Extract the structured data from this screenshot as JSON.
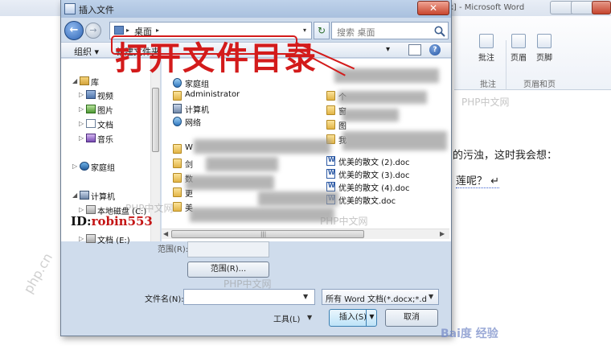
{
  "word": {
    "title": "x] - Microsoft Word",
    "ribbon": {
      "comment_label": "批注",
      "header_label": "页眉",
      "footer_label": "页脚",
      "group_comment": "批注",
      "group_header_footer": "页眉和页"
    },
    "doc_line1": "的污浊，这时我会想：",
    "doc_line2": "莲呢？ ↵"
  },
  "dialog": {
    "title": "插入文件",
    "close_glyph": "✕",
    "address": {
      "location": "桌面",
      "separator": "▸"
    },
    "search_placeholder": "搜索 桌面",
    "toolbar": {
      "organize": "组织 ▾",
      "new_folder": "新建文件夹"
    },
    "nav_tree": [
      {
        "label": "库",
        "icon": "library-icon"
      },
      {
        "label": "视频",
        "icon": "video-folder-icon"
      },
      {
        "label": "图片",
        "icon": "pictures-folder-icon"
      },
      {
        "label": "文档",
        "icon": "documents-folder-icon"
      },
      {
        "label": "音乐",
        "icon": "music-folder-icon"
      },
      {
        "label": "家庭组",
        "icon": "homegroup-icon"
      },
      {
        "label": "计算机",
        "icon": "computer-icon"
      },
      {
        "label": "本地磁盘 (C:)",
        "icon": "drive-icon"
      },
      {
        "label": "文档 (E:)",
        "icon": "drive-icon"
      }
    ],
    "files_col1": [
      {
        "label": "家庭组",
        "icon": "homegroup-icon"
      },
      {
        "label": "Administrator",
        "icon": "user-folder-icon"
      },
      {
        "label": "计算机",
        "icon": "computer-icon"
      },
      {
        "label": "网络",
        "icon": "network-icon"
      },
      {
        "label": "W",
        "icon": "folder-icon"
      },
      {
        "label": "剑",
        "icon": "folder-icon"
      },
      {
        "label": "数",
        "icon": "folder-icon"
      },
      {
        "label": "更",
        "icon": "folder-icon"
      },
      {
        "label": "美",
        "icon": "folder-icon"
      }
    ],
    "files_col2": [
      {
        "label": "个",
        "icon": "folder-icon"
      },
      {
        "label": "窗",
        "icon": "folder-icon"
      },
      {
        "label": "图",
        "icon": "folder-icon"
      },
      {
        "label": "我",
        "icon": "folder-icon"
      },
      {
        "label": "优美的散文 (2).doc",
        "icon": "word-doc-icon"
      },
      {
        "label": "优美的散文 (3).doc",
        "icon": "word-doc-icon"
      },
      {
        "label": "优美的散文 (4).doc",
        "icon": "word-doc-icon"
      },
      {
        "label": "优美的散文.doc",
        "icon": "word-doc-icon"
      }
    ],
    "range_label": "范围(R):",
    "range_button": "范围(R)...",
    "filename_label": "文件名(N):",
    "filename_value": "",
    "filter_value": "所有 Word 文档(*.docx;*.doc",
    "tools_label": "工具(L)",
    "insert_label": "插入(S)",
    "cancel_label": "取消"
  },
  "overlay": {
    "annotation": "打开文件目录",
    "id_prefix": "ID:",
    "id_name": "robin553",
    "watermark": "PHP中文网",
    "watermark_rot": "php.cn",
    "baidu": "Bai度 经验"
  },
  "colors": {
    "annotation_red": "#d31b1b",
    "dialog_frame": "#cfdcec",
    "accent_blue": "#2f65b5"
  }
}
